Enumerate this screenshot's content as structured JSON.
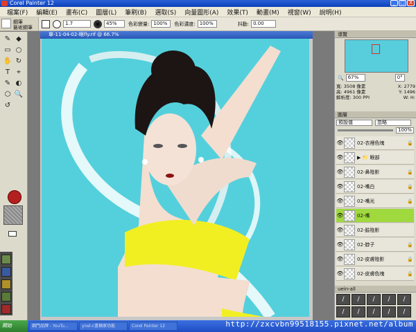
{
  "window": {
    "title": "Corel Painter 12",
    "min": "_",
    "max": "□",
    "close": "X"
  },
  "menu": [
    "檔案(F)",
    "編輯(E)",
    "畫布(C)",
    "圖層(L)",
    "筆刷(B)",
    "選取(S)",
    "向量圖形(A)",
    "效果(T)",
    "動畫(M)",
    "視窗(W)",
    "說明(H)"
  ],
  "toolbar": {
    "brush_category": "鋼筆",
    "brush_variant": "藝術鋼筆",
    "size": "1.7",
    "opacity": "45%",
    "opacity_label": "色彩變量:",
    "h": "100%",
    "s_label": "色彩濃度:",
    "s": "100%",
    "grain_label": "抖動:",
    "grain": "0.00"
  },
  "document": {
    "title": "單-11-04-02-眼fly.rif @ 66.7%"
  },
  "left_tools": [
    "✎",
    "◆",
    "▭",
    "○",
    "✋",
    "↻",
    "T",
    "⌖",
    "✎",
    "◐",
    "⬡",
    "🔍",
    "↺"
  ],
  "navigator": {
    "title": "導覽",
    "zoom": "67%",
    "rotation": "0°"
  },
  "info": {
    "w_label": "寬:",
    "w": "3508 像素",
    "h_label": "高:",
    "h": "4961 像素",
    "res_label": "解析度:",
    "res": "300 PPI",
    "x_label": "X:",
    "x": "2779",
    "y_label": "Y:",
    "y": "1496",
    "wl_label": "W:",
    "hl_label": "H:"
  },
  "layers": {
    "title": "圖層",
    "blend": "預設值",
    "comp": "忽略",
    "opacity": "100%",
    "items": [
      {
        "name": "02-衣裡色塊",
        "selected": false,
        "lock": "🔒"
      },
      {
        "name": "▶ 📁 眼部",
        "selected": false,
        "lock": ""
      },
      {
        "name": "02-鼻陰影",
        "selected": false,
        "lock": "🔒"
      },
      {
        "name": "02-嘴白",
        "selected": false,
        "lock": "🔒"
      },
      {
        "name": "02-嘴光",
        "selected": false,
        "lock": "🔒"
      },
      {
        "name": "02-嘴",
        "selected": true,
        "lock": ""
      },
      {
        "name": "02-臉陰影",
        "selected": false,
        "lock": ""
      },
      {
        "name": "02-脖子",
        "selected": false,
        "lock": "🔒"
      },
      {
        "name": "02-皮膚陰影",
        "selected": false,
        "lock": "🔒"
      },
      {
        "name": "02-皮膚色塊",
        "selected": false,
        "lock": "🔒"
      }
    ]
  },
  "brushes": {
    "title": "uein-all"
  },
  "taskbar": {
    "start": "開始",
    "tasks": [
      "鋼門品牌 - YouTu...",
      "ynel-c書稿家功能",
      "Corel Painter 12"
    ]
  },
  "watermark": "http://zxcvbn99518155.pixnet.net/album"
}
